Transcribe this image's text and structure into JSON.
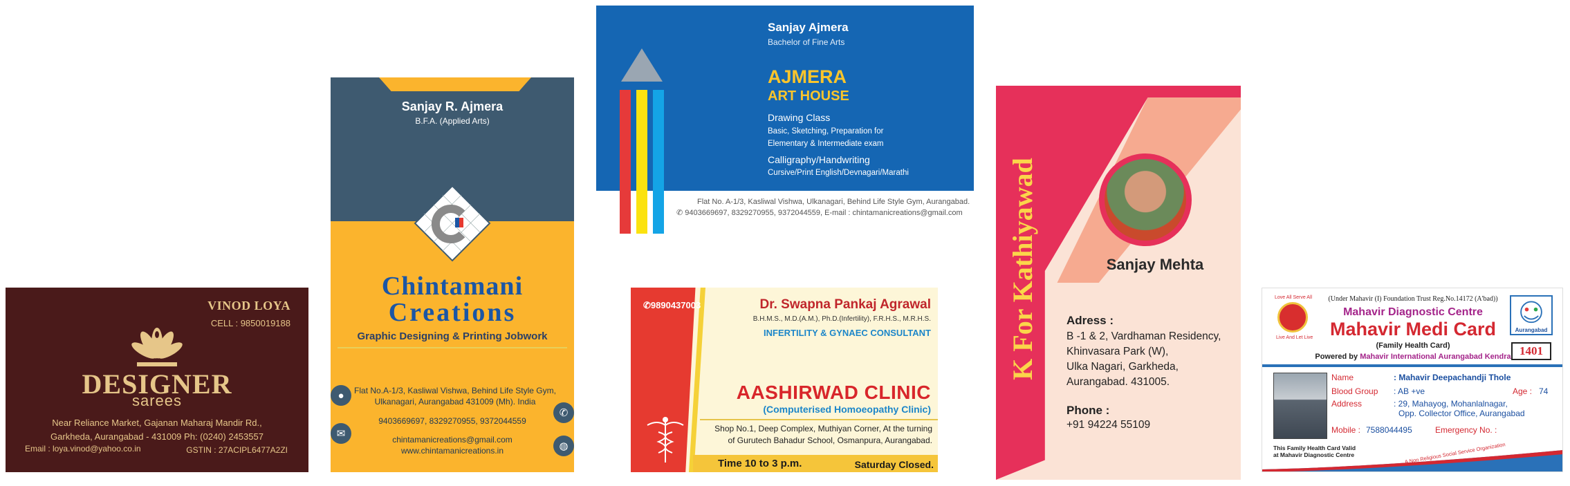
{
  "card_designer_sarees": {
    "name": "VINOD LOYA",
    "cell": "CELL : 9850019188",
    "brand_main": "DESIGNER",
    "brand_sub": "sarees",
    "address_line1": "Near Reliance Market, Gajanan Maharaj Mandir Rd.,",
    "address_line2": "Garkheda, Aurangabad - 431009  Ph: (0240) 2453557",
    "email": "Email : loya.vinod@yahoo.co.in",
    "gstin": "GSTIN : 27ACIPL6477A2ZI",
    "colors": {
      "background": "#4a1a1a",
      "gold": "#e6c689"
    }
  },
  "card_chintamani_vertical": {
    "name": "Sanjay R. Ajmera",
    "degree": "B.F.A. (Applied Arts)",
    "brand_line1": "Chintamani",
    "brand_line2": "Creations",
    "tagline": "Graphic Designing &  Printing Jobwork",
    "address": "Flat No.A-1/3, Kasliwal Vishwa, Behind Life Style Gym, Ulkanagari, Aurangabad 431009 (Mh). India",
    "phone": "9403669697, 8329270955, 9372044559",
    "email": "chintamanicreations@gmail.com",
    "website": "www.chintamanicreations.in",
    "icons": [
      "location-icon",
      "mail-icon",
      "phone-icon",
      "globe-icon"
    ],
    "colors": {
      "slate": "#3e5a70",
      "amber": "#fbb42d",
      "blue": "#1b56a5"
    }
  },
  "card_ajmera_art_house": {
    "name": "Sanjay Ajmera",
    "degree": "Bachelor of Fine Arts",
    "brand_line1": "AJMERA",
    "brand_line2": "ART HOUSE",
    "drawing_title": "Drawing Class",
    "drawing_desc_line1": "Basic, Sketching, Preparation for",
    "drawing_desc_line2": "Elementary & Intermediate exam",
    "calligraphy_title": "Calligraphy/Handwriting",
    "calligraphy_desc": "Cursive/Print English/Devnagari/Marathi",
    "address": "Flat No. A-1/3, Kasliwal Vishwa, Ulkanagari, Behind Life Style Gym, Aurangabad.",
    "phone_email": "9403669697, 8329270955, 9372044559, E-mail : chintamanicreations@gmail.com",
    "phone_glyph": "✆",
    "colors": {
      "blue": "#1566b3",
      "yellow": "#fbc52b"
    }
  },
  "card_aashirwad_clinic": {
    "phone": "9890437003",
    "doctor": "Dr. Swapna Pankaj Agrawal",
    "qualifications": "B.H.M.S., M.D.(A.M.), Ph.D.(Infertility), F.R.H.S., M.R.H.S.",
    "speciality": "INFERTILITY & GYNAEC CONSULTANT",
    "clinic": "AASHIRWAD CLINIC",
    "clinic_sub": "(Computerised Homoeopathy Clinic)",
    "address_line1": "Shop No.1, Deep Complex, Muthiyan Corner, At the turning",
    "address_line2": "of Gurutech Bahadur School, Osmanpura, Aurangabad.",
    "time": "Time 10 to 3 p.m.",
    "closed": "Saturday Closed.",
    "colors": {
      "red": "#e63a30",
      "cream": "#fdf6d8",
      "yellow": "#f5c53a"
    }
  },
  "card_kathiyawad": {
    "vertical_title": "K For Kathiyawad",
    "name": "Sanjay Mehta",
    "address_label": "Adress :",
    "address_line1": "B -1 & 2, Vardhaman Residency,",
    "address_line2": "Khinvasara Park (W),",
    "address_line3": "Ulka Nagari, Garkheda,",
    "address_line4": "Aurangabad. 431005.",
    "phone_label": "Phone :",
    "phone": "+91 94224 55109",
    "colors": {
      "pink": "#e6305a",
      "peach": "#f6aa90",
      "gold": "#fbd64a"
    }
  },
  "card_mahavir_medi": {
    "trust": "(Under Mahavir (I) Foundation Trust Reg.No.14172 (A'bad))",
    "motto_top": "Love All Serve All",
    "motto_bottom": "Live And Let Live",
    "right_logo_label": "Aurangabad",
    "centre": "Mahavir Diagnostic Centre",
    "title": "Mahavir Medi Card",
    "subtitle": "(Family Health Card)",
    "powered_prefix": "Powered by",
    "powered_org": "Mahavir International Aurangabad Kendra",
    "card_number": "1401",
    "fields": {
      "name_label": "Name",
      "name_value": ": Mahavir Deepachandji Thole",
      "blood_label": "Blood Group",
      "blood_value": ": AB +ve",
      "age_label": "Age :",
      "age_value": "74",
      "address_label": "Address",
      "address_line1": ": 29, Mahayog, Mohanlalnagar,",
      "address_line2": "Opp. Collector Office, Aurangabad",
      "mobile_label": "Mobile :",
      "mobile_value": "7588044495",
      "emergency_label": "Emergency No. :"
    },
    "valid_line1": "This Family Health Card Valid",
    "valid_line2": "at Mahavir Diagnostic Centre",
    "ngo": "A Non Religious Social Service Organization",
    "colors": {
      "magenta": "#a4248a",
      "red": "#d42831",
      "blue": "#1b4fa0"
    }
  }
}
